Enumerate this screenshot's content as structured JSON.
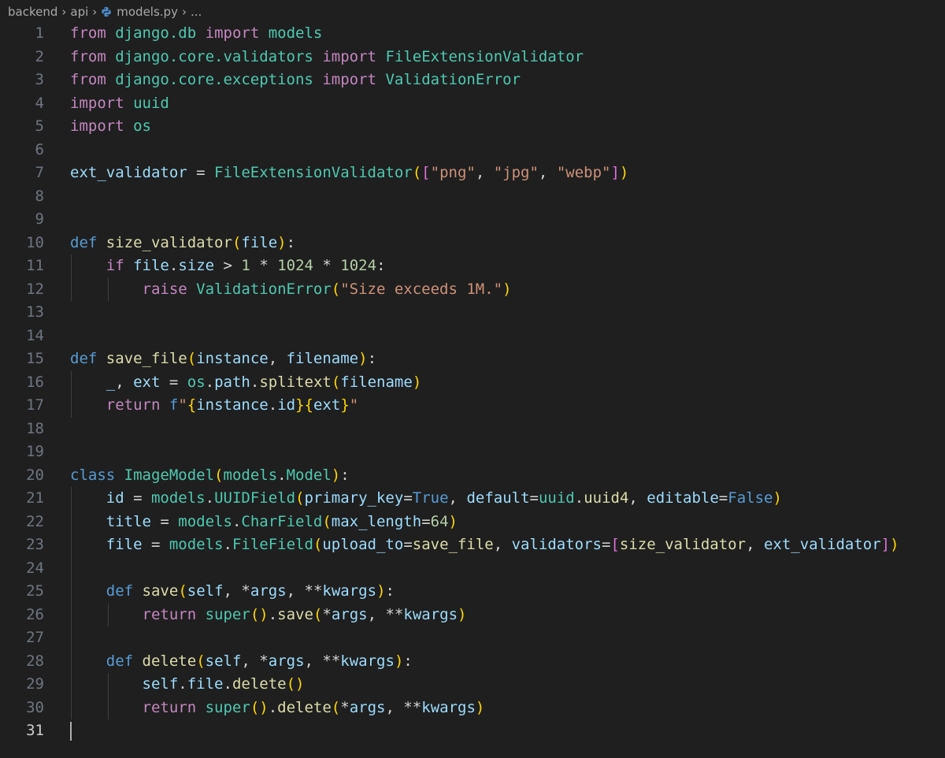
{
  "breadcrumb": {
    "parts": [
      "backend",
      "api"
    ],
    "file": "models.py",
    "more": "..."
  },
  "colors": {
    "background": "#1f1f1f",
    "keyword": "#c586c0",
    "storage": "#569cd6",
    "function": "#dcdcaa",
    "class": "#4ec9b0",
    "variable": "#9cdcfe",
    "string": "#ce9178",
    "number": "#b5cea8"
  },
  "editor": {
    "active_line": 31,
    "lines": [
      [
        [
          "kw",
          "from"
        ],
        [
          "op",
          " "
        ],
        [
          "cls",
          "django.db"
        ],
        [
          "op",
          " "
        ],
        [
          "kw",
          "import"
        ],
        [
          "op",
          " "
        ],
        [
          "cls",
          "models"
        ]
      ],
      [
        [
          "kw",
          "from"
        ],
        [
          "op",
          " "
        ],
        [
          "cls",
          "django.core.validators"
        ],
        [
          "op",
          " "
        ],
        [
          "kw",
          "import"
        ],
        [
          "op",
          " "
        ],
        [
          "cls",
          "FileExtensionValidator"
        ]
      ],
      [
        [
          "kw",
          "from"
        ],
        [
          "op",
          " "
        ],
        [
          "cls",
          "django.core.exceptions"
        ],
        [
          "op",
          " "
        ],
        [
          "kw",
          "import"
        ],
        [
          "op",
          " "
        ],
        [
          "cls",
          "ValidationError"
        ]
      ],
      [
        [
          "kw",
          "import"
        ],
        [
          "op",
          " "
        ],
        [
          "cls",
          "uuid"
        ]
      ],
      [
        [
          "kw",
          "import"
        ],
        [
          "op",
          " "
        ],
        [
          "cls",
          "os"
        ]
      ],
      [],
      [
        [
          "var",
          "ext_validator"
        ],
        [
          "op",
          " = "
        ],
        [
          "cls",
          "FileExtensionValidator"
        ],
        [
          "b1",
          "("
        ],
        [
          "b2",
          "["
        ],
        [
          "str",
          "\"png\""
        ],
        [
          "op",
          ", "
        ],
        [
          "str",
          "\"jpg\""
        ],
        [
          "op",
          ", "
        ],
        [
          "str",
          "\"webp\""
        ],
        [
          "b2",
          "]"
        ],
        [
          "b1",
          ")"
        ]
      ],
      [],
      [],
      [
        [
          "def",
          "def"
        ],
        [
          "op",
          " "
        ],
        [
          "fn",
          "size_validator"
        ],
        [
          "b1",
          "("
        ],
        [
          "var",
          "file"
        ],
        [
          "b1",
          ")"
        ],
        [
          "op",
          ":"
        ]
      ],
      [
        [
          "op",
          "    "
        ],
        [
          "kw",
          "if"
        ],
        [
          "op",
          " "
        ],
        [
          "var",
          "file"
        ],
        [
          "op",
          "."
        ],
        [
          "var",
          "size"
        ],
        [
          "op",
          " > "
        ],
        [
          "num",
          "1"
        ],
        [
          "op",
          " * "
        ],
        [
          "num",
          "1024"
        ],
        [
          "op",
          " * "
        ],
        [
          "num",
          "1024"
        ],
        [
          "op",
          ":"
        ]
      ],
      [
        [
          "op",
          "        "
        ],
        [
          "kw",
          "raise"
        ],
        [
          "op",
          " "
        ],
        [
          "cls",
          "ValidationError"
        ],
        [
          "b1",
          "("
        ],
        [
          "str",
          "\"Size exceeds 1M.\""
        ],
        [
          "b1",
          ")"
        ]
      ],
      [],
      [],
      [
        [
          "def",
          "def"
        ],
        [
          "op",
          " "
        ],
        [
          "fn",
          "save_file"
        ],
        [
          "b1",
          "("
        ],
        [
          "var",
          "instance"
        ],
        [
          "op",
          ", "
        ],
        [
          "var",
          "filename"
        ],
        [
          "b1",
          ")"
        ],
        [
          "op",
          ":"
        ]
      ],
      [
        [
          "op",
          "    "
        ],
        [
          "var",
          "_"
        ],
        [
          "op",
          ", "
        ],
        [
          "var",
          "ext"
        ],
        [
          "op",
          " = "
        ],
        [
          "cls",
          "os"
        ],
        [
          "op",
          "."
        ],
        [
          "var",
          "path"
        ],
        [
          "op",
          "."
        ],
        [
          "fn",
          "splitext"
        ],
        [
          "b1",
          "("
        ],
        [
          "var",
          "filename"
        ],
        [
          "b1",
          ")"
        ]
      ],
      [
        [
          "op",
          "    "
        ],
        [
          "kw",
          "return"
        ],
        [
          "op",
          " "
        ],
        [
          "fstr",
          "f"
        ],
        [
          "str",
          "\""
        ],
        [
          "b1",
          "{"
        ],
        [
          "var",
          "instance"
        ],
        [
          "op",
          "."
        ],
        [
          "var",
          "id"
        ],
        [
          "b1",
          "}"
        ],
        [
          "b1",
          "{"
        ],
        [
          "var",
          "ext"
        ],
        [
          "b1",
          "}"
        ],
        [
          "str",
          "\""
        ]
      ],
      [],
      [],
      [
        [
          "def",
          "class"
        ],
        [
          "op",
          " "
        ],
        [
          "cls",
          "ImageModel"
        ],
        [
          "b1",
          "("
        ],
        [
          "cls",
          "models"
        ],
        [
          "op",
          "."
        ],
        [
          "cls",
          "Model"
        ],
        [
          "b1",
          ")"
        ],
        [
          "op",
          ":"
        ]
      ],
      [
        [
          "op",
          "    "
        ],
        [
          "var",
          "id"
        ],
        [
          "op",
          " = "
        ],
        [
          "cls",
          "models"
        ],
        [
          "op",
          "."
        ],
        [
          "cls",
          "UUIDField"
        ],
        [
          "b1",
          "("
        ],
        [
          "var",
          "primary_key"
        ],
        [
          "op",
          "="
        ],
        [
          "def",
          "True"
        ],
        [
          "op",
          ", "
        ],
        [
          "var",
          "default"
        ],
        [
          "op",
          "="
        ],
        [
          "cls",
          "uuid"
        ],
        [
          "op",
          "."
        ],
        [
          "fn",
          "uuid4"
        ],
        [
          "op",
          ", "
        ],
        [
          "var",
          "editable"
        ],
        [
          "op",
          "="
        ],
        [
          "def",
          "False"
        ],
        [
          "b1",
          ")"
        ]
      ],
      [
        [
          "op",
          "    "
        ],
        [
          "var",
          "title"
        ],
        [
          "op",
          " = "
        ],
        [
          "cls",
          "models"
        ],
        [
          "op",
          "."
        ],
        [
          "cls",
          "CharField"
        ],
        [
          "b1",
          "("
        ],
        [
          "var",
          "max_length"
        ],
        [
          "op",
          "="
        ],
        [
          "num",
          "64"
        ],
        [
          "b1",
          ")"
        ]
      ],
      [
        [
          "op",
          "    "
        ],
        [
          "var",
          "file"
        ],
        [
          "op",
          " = "
        ],
        [
          "cls",
          "models"
        ],
        [
          "op",
          "."
        ],
        [
          "cls",
          "FileField"
        ],
        [
          "b1",
          "("
        ],
        [
          "var",
          "upload_to"
        ],
        [
          "op",
          "="
        ],
        [
          "fn",
          "save_file"
        ],
        [
          "op",
          ", "
        ],
        [
          "var",
          "validators"
        ],
        [
          "op",
          "="
        ],
        [
          "b2",
          "["
        ],
        [
          "fn",
          "size_validator"
        ],
        [
          "op",
          ", "
        ],
        [
          "var",
          "ext_validator"
        ],
        [
          "b2",
          "]"
        ],
        [
          "b1",
          ")"
        ]
      ],
      [],
      [
        [
          "op",
          "    "
        ],
        [
          "def",
          "def"
        ],
        [
          "op",
          " "
        ],
        [
          "fn",
          "save"
        ],
        [
          "b1",
          "("
        ],
        [
          "var",
          "self"
        ],
        [
          "op",
          ", "
        ],
        [
          "op",
          "*"
        ],
        [
          "var",
          "args"
        ],
        [
          "op",
          ", "
        ],
        [
          "op",
          "**"
        ],
        [
          "var",
          "kwargs"
        ],
        [
          "b1",
          ")"
        ],
        [
          "op",
          ":"
        ]
      ],
      [
        [
          "op",
          "        "
        ],
        [
          "kw",
          "return"
        ],
        [
          "op",
          " "
        ],
        [
          "cls",
          "super"
        ],
        [
          "b1",
          "()"
        ],
        [
          "op",
          "."
        ],
        [
          "fn",
          "save"
        ],
        [
          "b1",
          "("
        ],
        [
          "op",
          "*"
        ],
        [
          "var",
          "args"
        ],
        [
          "op",
          ", "
        ],
        [
          "op",
          "**"
        ],
        [
          "var",
          "kwargs"
        ],
        [
          "b1",
          ")"
        ]
      ],
      [],
      [
        [
          "op",
          "    "
        ],
        [
          "def",
          "def"
        ],
        [
          "op",
          " "
        ],
        [
          "fn",
          "delete"
        ],
        [
          "b1",
          "("
        ],
        [
          "var",
          "self"
        ],
        [
          "op",
          ", "
        ],
        [
          "op",
          "*"
        ],
        [
          "var",
          "args"
        ],
        [
          "op",
          ", "
        ],
        [
          "op",
          "**"
        ],
        [
          "var",
          "kwargs"
        ],
        [
          "b1",
          ")"
        ],
        [
          "op",
          ":"
        ]
      ],
      [
        [
          "op",
          "        "
        ],
        [
          "var",
          "self"
        ],
        [
          "op",
          "."
        ],
        [
          "var",
          "file"
        ],
        [
          "op",
          "."
        ],
        [
          "fn",
          "delete"
        ],
        [
          "b1",
          "()"
        ]
      ],
      [
        [
          "op",
          "        "
        ],
        [
          "kw",
          "return"
        ],
        [
          "op",
          " "
        ],
        [
          "cls",
          "super"
        ],
        [
          "b1",
          "()"
        ],
        [
          "op",
          "."
        ],
        [
          "fn",
          "delete"
        ],
        [
          "b1",
          "("
        ],
        [
          "op",
          "*"
        ],
        [
          "var",
          "args"
        ],
        [
          "op",
          ", "
        ],
        [
          "op",
          "**"
        ],
        [
          "var",
          "kwargs"
        ],
        [
          "b1",
          ")"
        ]
      ],
      []
    ],
    "guides": {
      "11": [
        90
      ],
      "12": [
        90,
        137
      ],
      "16": [
        90
      ],
      "17": [
        90
      ],
      "21": [
        90
      ],
      "22": [
        90
      ],
      "23": [
        90
      ],
      "24": [
        90
      ],
      "25": [
        90
      ],
      "26": [
        90,
        137
      ],
      "27": [
        90
      ],
      "28": [
        90
      ],
      "29": [
        90,
        137
      ],
      "30": [
        90,
        137
      ]
    }
  }
}
